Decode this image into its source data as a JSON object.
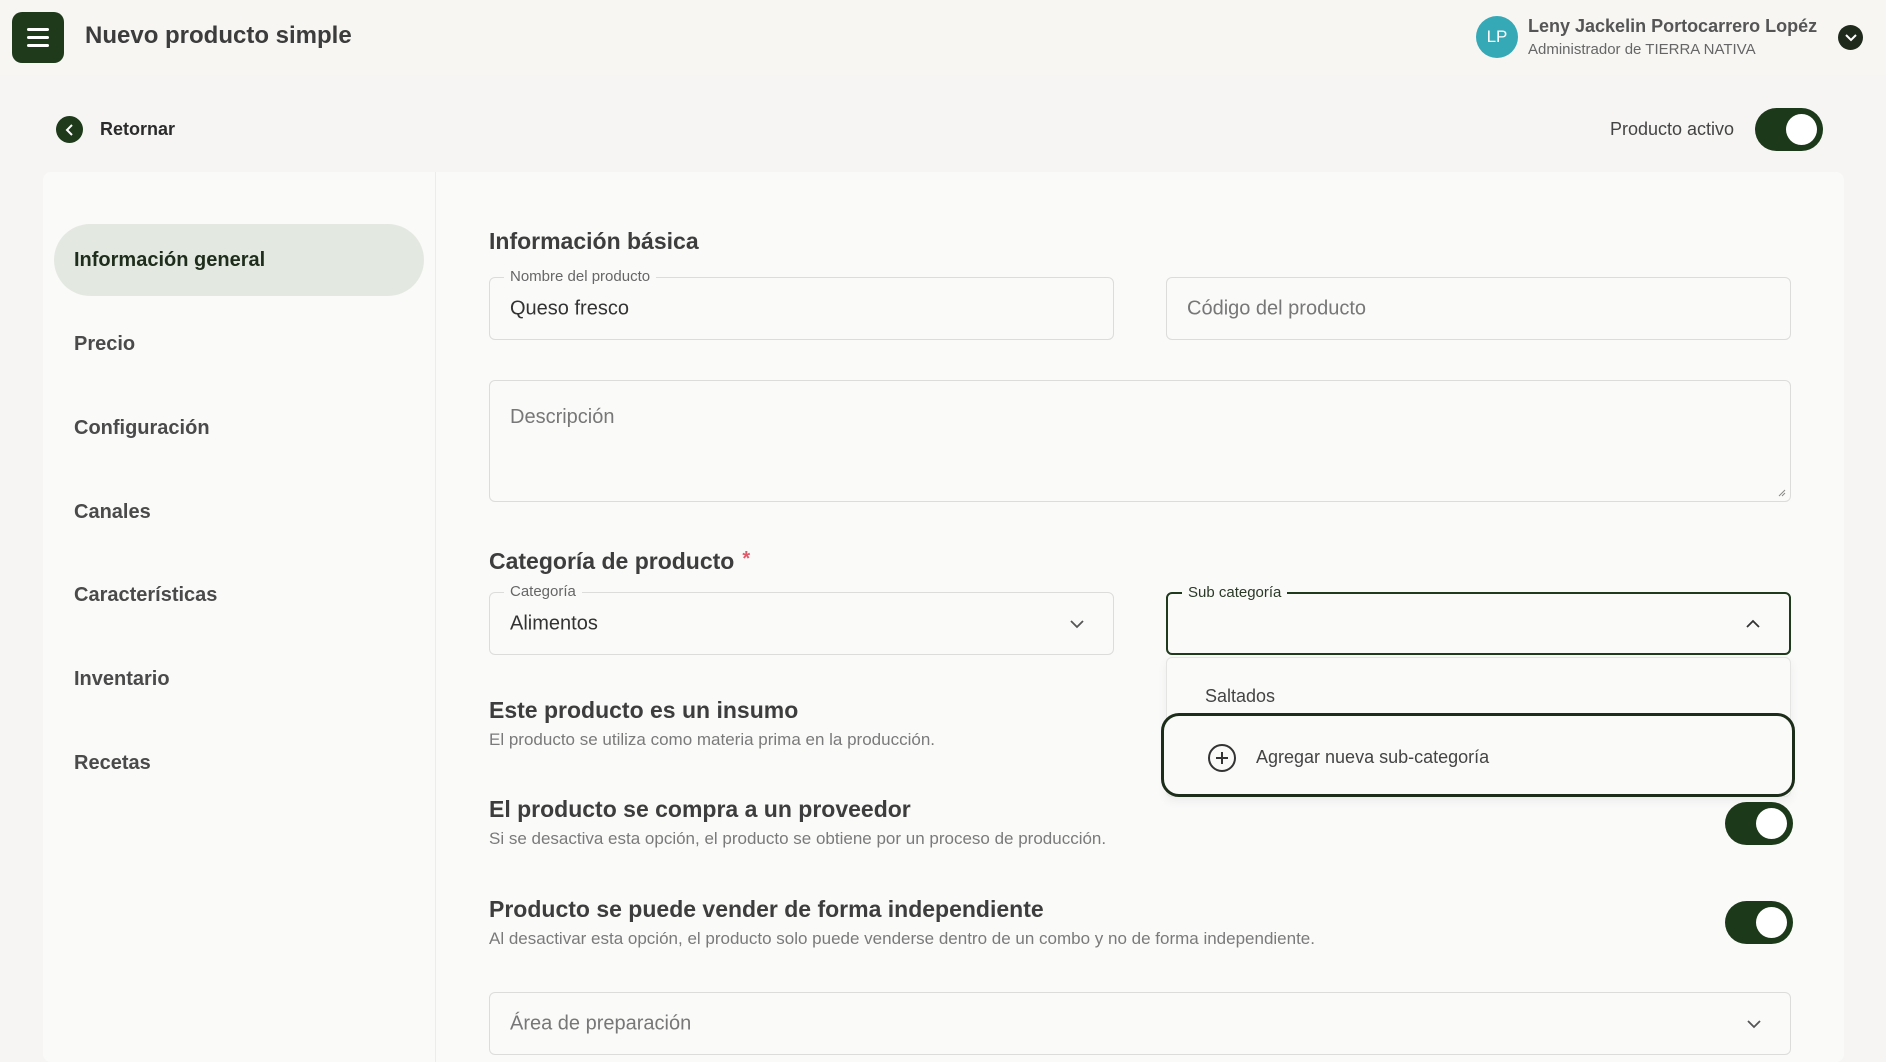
{
  "header": {
    "title": "Nuevo producto simple",
    "user": {
      "initials": "LP",
      "name": "Leny Jackelin Portocarrero Lopéz",
      "role": "Administrador de TIERRA NATIVA"
    }
  },
  "topline": {
    "back_label": "Retornar",
    "active_label": "Producto activo",
    "active_on": true
  },
  "sidebar": {
    "items": [
      {
        "label": "Información general",
        "active": true
      },
      {
        "label": "Precio"
      },
      {
        "label": "Configuración"
      },
      {
        "label": "Canales"
      },
      {
        "label": "Características"
      },
      {
        "label": "Inventario"
      },
      {
        "label": "Recetas"
      }
    ]
  },
  "basic": {
    "title": "Información básica",
    "name_label": "Nombre del producto",
    "name_value": "Queso fresco",
    "code_placeholder": "Código del producto",
    "description_placeholder": "Descripción"
  },
  "category": {
    "title": "Categoría de producto",
    "required_mark": "*",
    "category_label": "Categoría",
    "category_value": "Alimentos",
    "subcategory_label": "Sub categoría",
    "subcategory_value": "",
    "options": [
      "Saltados"
    ],
    "add_option": "Agregar nueva sub-categoría"
  },
  "settings": [
    {
      "title": "Este producto es un insumo",
      "description": "El producto se utiliza como materia prima en la producción."
    },
    {
      "title": "El producto se compra a un proveedor",
      "description": "Si se desactiva esta opción, el producto se obtiene por un proceso de producción.",
      "on": true
    },
    {
      "title": "Producto se puede vender de forma independiente",
      "description": "Al desactivar esta opción, el producto solo puede venderse dentro de un combo y no de forma independiente.",
      "on": true
    }
  ],
  "prep_area": {
    "placeholder": "Área de preparación"
  },
  "colors": {
    "primary": "#1c3a1a",
    "accent_avatar": "#35a9b6",
    "active_nav_bg": "#e3e9e1",
    "required": "#e05a6a"
  }
}
